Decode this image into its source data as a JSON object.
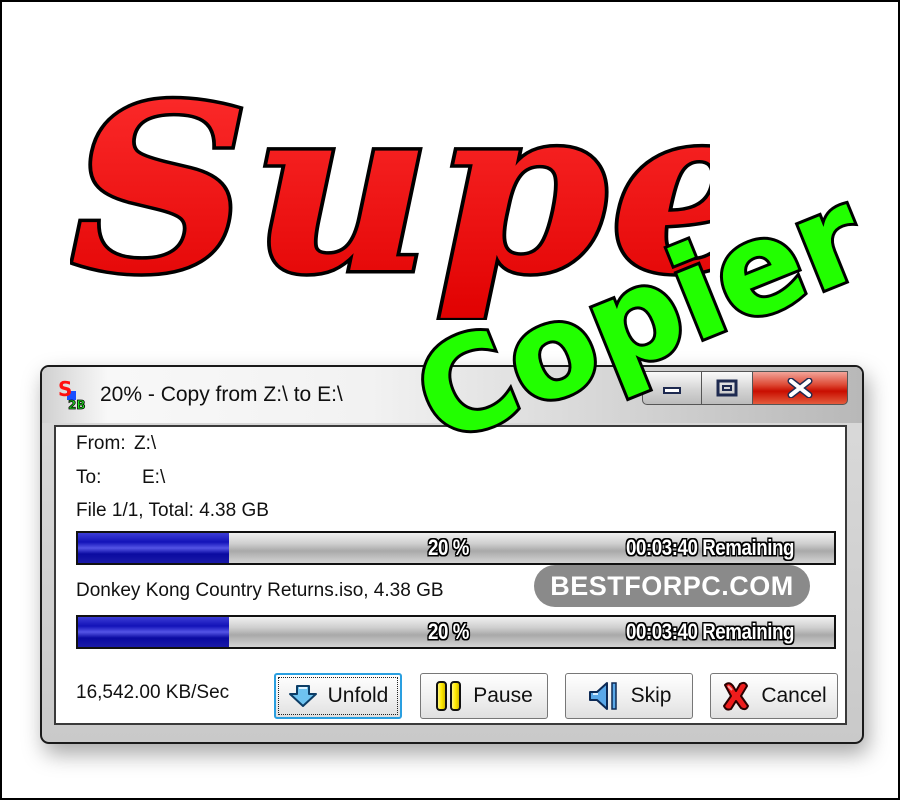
{
  "banner": {
    "title_word1": "Super",
    "title_word2": "Copier",
    "title_word1_color": "#ff0000",
    "title_word2_color": "#22ff00"
  },
  "window": {
    "title": "20% - Copy from Z:\\ to E:\\",
    "app_icon": "supercopier-icon",
    "controls": [
      "minimize",
      "maximize",
      "close"
    ]
  },
  "info": {
    "from_label": "From:",
    "from_value": "Z:\\",
    "to_label": "To:",
    "to_value": "E:\\",
    "total_text": "File 1/1, Total: 4.38 GB",
    "current_file_text": "Donkey Kong Country Returns.iso, 4.38 GB"
  },
  "progress_total": {
    "percent": 20,
    "percent_label": "20 %",
    "remaining_label": "00:03:40 Remaining"
  },
  "progress_file": {
    "percent": 20,
    "percent_label": "20 %",
    "remaining_label": "00:03:40 Remaining"
  },
  "watermark": "BESTFORPC.COM",
  "speed": "16,542.00 KB/Sec",
  "buttons": {
    "unfold": "Unfold",
    "pause": "Pause",
    "skip": "Skip",
    "cancel": "Cancel"
  },
  "colors": {
    "progress_fill": "#1313b8",
    "close_button": "#c90e00",
    "focus_border": "#2a9fe0"
  }
}
